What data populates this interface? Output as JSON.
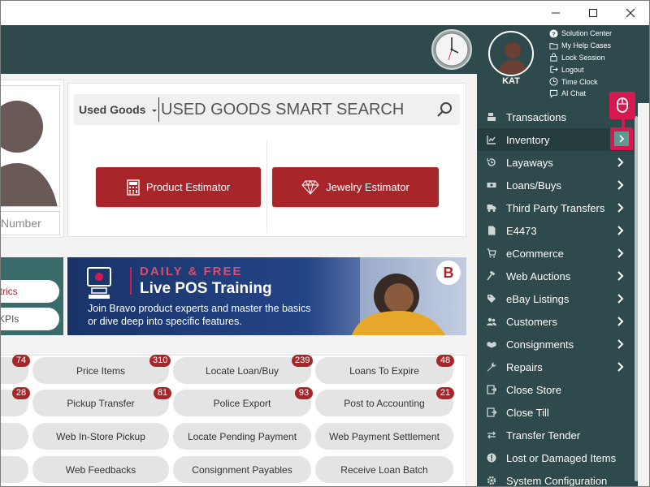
{
  "header": {
    "username": "KAT",
    "links": [
      {
        "icon": "question-circle-icon",
        "label": "Solution Center"
      },
      {
        "icon": "folder-icon",
        "label": "My Help Cases"
      },
      {
        "icon": "lock-icon",
        "label": "Lock Session"
      },
      {
        "icon": "logout-icon",
        "label": "Logout"
      },
      {
        "icon": "clock-icon",
        "label": "Time Clock"
      },
      {
        "icon": "chat-icon",
        "label": "AI Chat"
      }
    ]
  },
  "search": {
    "category": "Used Goods",
    "placeholder": "USED GOODS SMART SEARCH"
  },
  "customer": {
    "number_placeholder": "Number"
  },
  "estimators": {
    "product": "Product Estimator",
    "jewelry": "Jewelry Estimator"
  },
  "metrics": {
    "item1": "Metrics",
    "item2": "KPIs"
  },
  "banner": {
    "kicker": "DAILY & FREE",
    "title": "Live POS Training",
    "line1": "Join Bravo product experts and master the basics",
    "line2": "or dive deep into specific features.",
    "logo_letter": "B"
  },
  "quick_actions": [
    {
      "label": "Price Items",
      "badge": "310"
    },
    {
      "label": "Locate Loan/Buy",
      "badge": "239"
    },
    {
      "label": "Loans To Expire",
      "badge": "48"
    },
    {
      "label": "Pickup Transfer",
      "badge": "81"
    },
    {
      "label": "Police Export",
      "badge": "93"
    },
    {
      "label": "Post to Accounting",
      "badge": "21"
    },
    {
      "label": "Web In-Store Pickup",
      "badge": ""
    },
    {
      "label": "Locate Pending Payment",
      "badge": ""
    },
    {
      "label": "Web Payment Settlement",
      "badge": ""
    },
    {
      "label": "Web Feedbacks",
      "badge": ""
    },
    {
      "label": "Consignment Payables",
      "badge": ""
    },
    {
      "label": "Receive Loan Batch",
      "badge": ""
    }
  ],
  "left_badges": [
    "74",
    "28"
  ],
  "nav": {
    "selected": "Inventory",
    "items": [
      {
        "label": "Transactions",
        "icon": "register-icon",
        "chevron": false
      },
      {
        "label": "Inventory",
        "icon": "chart-icon",
        "chevron": true
      },
      {
        "label": "Layaways",
        "icon": "history-icon",
        "chevron": true
      },
      {
        "label": "Loans/Buys",
        "icon": "money-icon",
        "chevron": true
      },
      {
        "label": "Third Party Transfers",
        "icon": "truck-icon",
        "chevron": true
      },
      {
        "label": "E4473",
        "icon": "document-icon",
        "chevron": true
      },
      {
        "label": "eCommerce",
        "icon": "cart-icon",
        "chevron": true
      },
      {
        "label": "Web Auctions",
        "icon": "gavel-icon",
        "chevron": true
      },
      {
        "label": "eBay Listings",
        "icon": "tag-icon",
        "chevron": true
      },
      {
        "label": "Customers",
        "icon": "users-icon",
        "chevron": true
      },
      {
        "label": "Consignments",
        "icon": "handshake-icon",
        "chevron": true
      },
      {
        "label": "Repairs",
        "icon": "wrench-icon",
        "chevron": true
      },
      {
        "label": "Close Store",
        "icon": "close-store-icon",
        "chevron": false
      },
      {
        "label": "Close Till",
        "icon": "close-till-icon",
        "chevron": false
      },
      {
        "label": "Transfer Tender",
        "icon": "transfer-icon",
        "chevron": false
      },
      {
        "label": "Lost or Damaged Items",
        "icon": "alert-icon",
        "chevron": false
      },
      {
        "label": "System Configuration",
        "icon": "gear-icon",
        "chevron": false
      }
    ]
  },
  "colors": {
    "header_bg": "#2f4a4c",
    "accent_red": "#a8262a",
    "highlight_pink": "#d6194e",
    "banner_blue": "#1d3b73"
  }
}
